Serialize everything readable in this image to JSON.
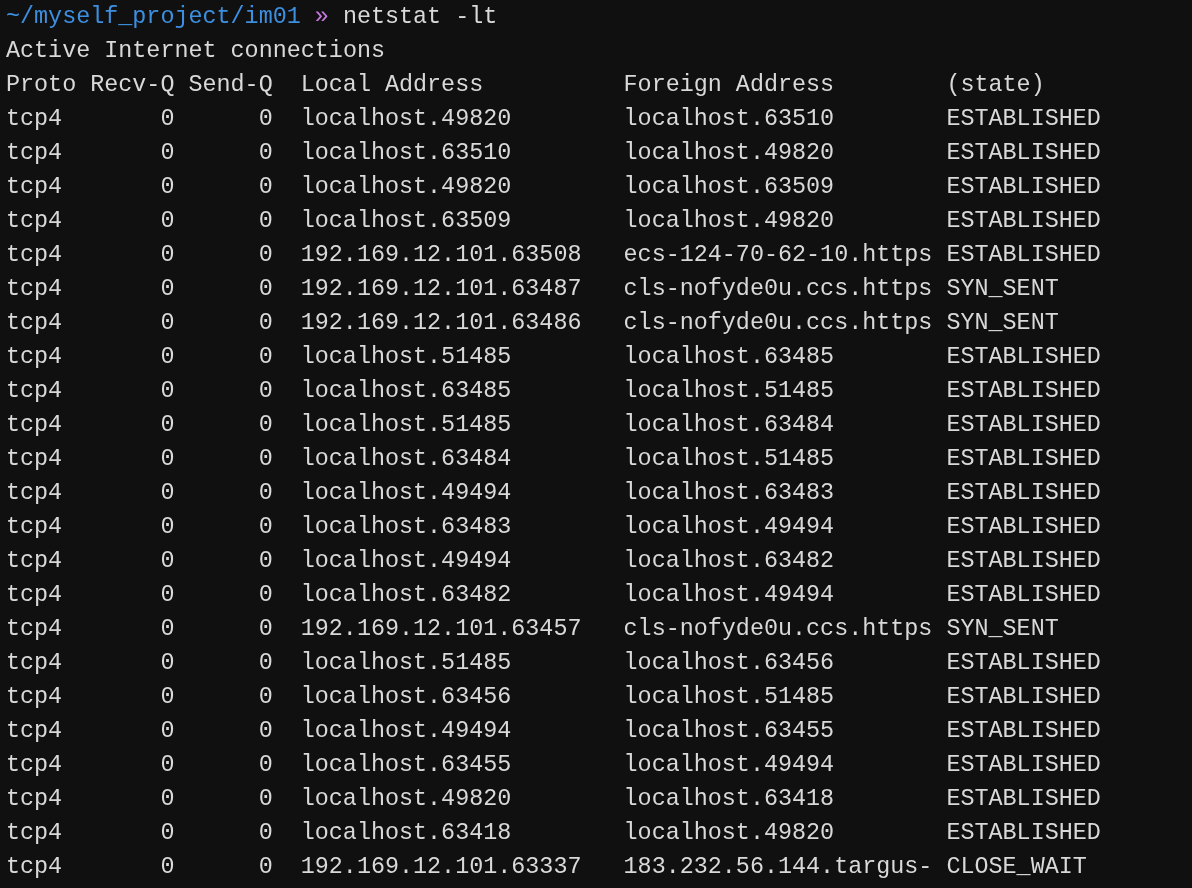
{
  "prompt": {
    "path": "~/myself_project/im01",
    "separator": "»",
    "command": "netstat -lt"
  },
  "heading": "Active Internet connections",
  "table": {
    "columns": [
      "Proto",
      "Recv-Q",
      "Send-Q",
      "Local Address",
      "Foreign Address",
      "(state)"
    ],
    "rows": [
      [
        "tcp4",
        "0",
        "0",
        "localhost.49820",
        "localhost.63510",
        "ESTABLISHED"
      ],
      [
        "tcp4",
        "0",
        "0",
        "localhost.63510",
        "localhost.49820",
        "ESTABLISHED"
      ],
      [
        "tcp4",
        "0",
        "0",
        "localhost.49820",
        "localhost.63509",
        "ESTABLISHED"
      ],
      [
        "tcp4",
        "0",
        "0",
        "localhost.63509",
        "localhost.49820",
        "ESTABLISHED"
      ],
      [
        "tcp4",
        "0",
        "0",
        "192.169.12.101.63508",
        "ecs-124-70-62-10.https",
        "ESTABLISHED"
      ],
      [
        "tcp4",
        "0",
        "0",
        "192.169.12.101.63487",
        "cls-nofyde0u.ccs.https",
        "SYN_SENT"
      ],
      [
        "tcp4",
        "0",
        "0",
        "192.169.12.101.63486",
        "cls-nofyde0u.ccs.https",
        "SYN_SENT"
      ],
      [
        "tcp4",
        "0",
        "0",
        "localhost.51485",
        "localhost.63485",
        "ESTABLISHED"
      ],
      [
        "tcp4",
        "0",
        "0",
        "localhost.63485",
        "localhost.51485",
        "ESTABLISHED"
      ],
      [
        "tcp4",
        "0",
        "0",
        "localhost.51485",
        "localhost.63484",
        "ESTABLISHED"
      ],
      [
        "tcp4",
        "0",
        "0",
        "localhost.63484",
        "localhost.51485",
        "ESTABLISHED"
      ],
      [
        "tcp4",
        "0",
        "0",
        "localhost.49494",
        "localhost.63483",
        "ESTABLISHED"
      ],
      [
        "tcp4",
        "0",
        "0",
        "localhost.63483",
        "localhost.49494",
        "ESTABLISHED"
      ],
      [
        "tcp4",
        "0",
        "0",
        "localhost.49494",
        "localhost.63482",
        "ESTABLISHED"
      ],
      [
        "tcp4",
        "0",
        "0",
        "localhost.63482",
        "localhost.49494",
        "ESTABLISHED"
      ],
      [
        "tcp4",
        "0",
        "0",
        "192.169.12.101.63457",
        "cls-nofyde0u.ccs.https",
        "SYN_SENT"
      ],
      [
        "tcp4",
        "0",
        "0",
        "localhost.51485",
        "localhost.63456",
        "ESTABLISHED"
      ],
      [
        "tcp4",
        "0",
        "0",
        "localhost.63456",
        "localhost.51485",
        "ESTABLISHED"
      ],
      [
        "tcp4",
        "0",
        "0",
        "localhost.49494",
        "localhost.63455",
        "ESTABLISHED"
      ],
      [
        "tcp4",
        "0",
        "0",
        "localhost.63455",
        "localhost.49494",
        "ESTABLISHED"
      ],
      [
        "tcp4",
        "0",
        "0",
        "localhost.49820",
        "localhost.63418",
        "ESTABLISHED"
      ],
      [
        "tcp4",
        "0",
        "0",
        "localhost.63418",
        "localhost.49820",
        "ESTABLISHED"
      ],
      [
        "tcp4",
        "0",
        "0",
        "192.169.12.101.63337",
        "183.232.56.144.targus-",
        "CLOSE_WAIT"
      ]
    ]
  }
}
